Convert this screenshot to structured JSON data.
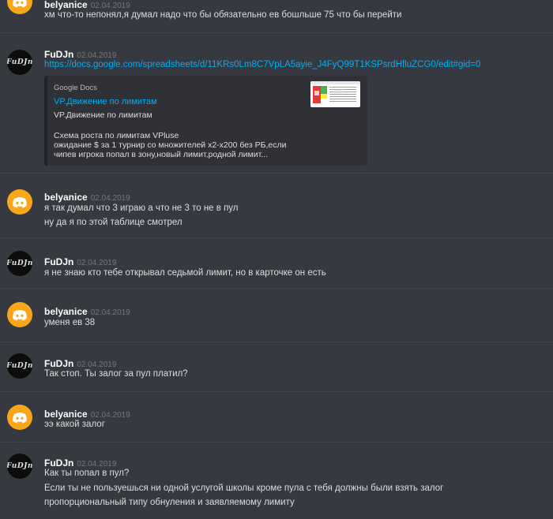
{
  "messages": [
    {
      "user": "belyanice",
      "time": "02.04.2019",
      "lines": [
        "хм что-то непонял,я думал надо что бы обязательно ев бошльше 75 что бы перейти"
      ]
    },
    {
      "user": "FuDJn",
      "time": "02.04.2019",
      "lines": [
        "https://docs.google.com/spreadsheets/d/11KRs0Lm8C7VpLA5ayie_J4FyQ99T1KSPsrdHfluZCG0/edit#gid=0"
      ],
      "embed": {
        "provider": "Google Docs",
        "title": "VP.Движение по лимитам",
        "desc": [
          "VP.Движение по лимитам",
          "",
          "Схема роста по лимитам VPluse",
          "ожидание $ за 1 турнир со множителей x2-x200 без РБ,если",
          "чипев игрока попал в зону,новый лимит,родной лимит..."
        ]
      }
    },
    {
      "user": "belyanice",
      "time": "02.04.2019",
      "lines": [
        "я так думал что 3 играю а что не 3 то не в пул",
        "ну да я по этой таблице смотрел"
      ]
    },
    {
      "user": "FuDJn",
      "time": "02.04.2019",
      "lines": [
        "я не знаю кто тебе открывал седьмой лимит, но в карточке он есть"
      ]
    },
    {
      "user": "belyanice",
      "time": "02.04.2019",
      "lines": [
        "уменя ев 38"
      ]
    },
    {
      "user": "FuDJn",
      "time": "02.04.2019",
      "lines": [
        "Так стоп. Ты залог за пул платил?"
      ]
    },
    {
      "user": "belyanice",
      "time": "02.04.2019",
      "lines": [
        "ээ какой залог"
      ]
    },
    {
      "user": "FuDJn",
      "time": "02.04.2019",
      "lines": [
        "Как ты попал в пул?",
        "Если ты не пользуешься ни одной услугой школы кроме пула с тебя должны были взять залог",
        "пропорциональный типу обнуления и заявляемому лимиту"
      ]
    }
  ],
  "avatars": {
    "fudjn_text": "FuDJn"
  },
  "colors": {
    "background": "#36393f",
    "link": "#00b0f4",
    "username": "#ffffff",
    "timestamp": "#72767d",
    "discord_avatar": "#faa61a"
  }
}
